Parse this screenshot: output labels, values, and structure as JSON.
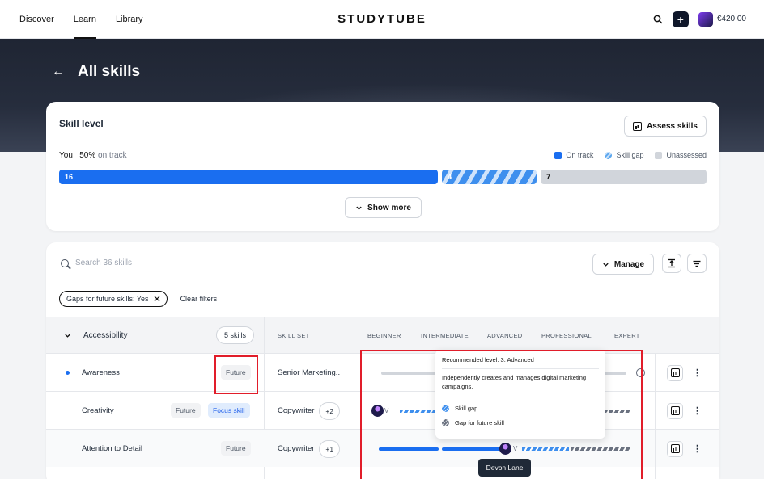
{
  "nav": {
    "links": [
      "Discover",
      "Learn",
      "Library"
    ],
    "logo": "STUDYTUBE",
    "balance": "€420,00",
    "plus": "+"
  },
  "hero": {
    "title": "All skills",
    "back": "←"
  },
  "skill_level": {
    "title": "Skill level",
    "assess_label": "Assess skills",
    "you_label": "You",
    "pct": "50%",
    "pct_suffix": "on track",
    "legend": [
      "On track",
      "Skill gap",
      "Unassessed"
    ],
    "segments": [
      {
        "label": "16",
        "value": 16
      },
      {
        "label": "4",
        "value": 4
      },
      {
        "label": "7",
        "value": 7
      }
    ],
    "show_more": "Show more"
  },
  "skills": {
    "search_placeholder": "Search 36 skills",
    "manage_label": "Manage",
    "filter_chip": "Gaps for future skills: Yes",
    "clear_filters": "Clear filters",
    "group": "Accessibility",
    "group_count": "5 skills",
    "columns": [
      "SKILL SET",
      "BEGINNER",
      "INTERMEDIATE",
      "ADVANCED",
      "PROFESSIONAL",
      "EXPERT"
    ],
    "rows": [
      {
        "name": "Awareness",
        "tags": [
          "Future"
        ],
        "skillset": "Senior Marketing..",
        "extra": ""
      },
      {
        "name": "Creativity",
        "tags": [
          "Future",
          "Focus skill"
        ],
        "skillset": "Copywriter",
        "extra": "+2"
      },
      {
        "name": "Attention to Detail",
        "tags": [
          "Future"
        ],
        "skillset": "Copywriter",
        "extra": "+1"
      }
    ],
    "avatar_letter": "V"
  },
  "tooltip": {
    "recommended": "Recommended level: 3. Advanced",
    "description": "Independently creates and manages digital marketing campaigns.",
    "legend": [
      "Skill gap",
      "Gap for future skill"
    ]
  },
  "hover_name": "Devon Lane"
}
